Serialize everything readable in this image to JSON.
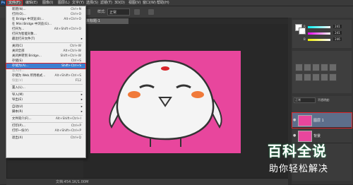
{
  "menubar": {
    "items": [
      {
        "label": "文件(F)",
        "active": true
      },
      {
        "label": "编辑(E)",
        "active": false
      },
      {
        "label": "图像(I)",
        "active": false
      },
      {
        "label": "图层(L)",
        "active": false
      },
      {
        "label": "文字(Y)",
        "active": false
      },
      {
        "label": "选择(S)",
        "active": false
      },
      {
        "label": "滤镜(T)",
        "active": false
      },
      {
        "label": "3D(D)",
        "active": false
      },
      {
        "label": "视图(V)",
        "active": false
      },
      {
        "label": "窗口(W)",
        "active": false
      },
      {
        "label": "帮助(H)",
        "active": false
      }
    ]
  },
  "options": {
    "style_label": "样式:",
    "style_value": "正常"
  },
  "document": {
    "tab": "未标题-1"
  },
  "status": {
    "text": "文档:454.1K/1.00M"
  },
  "file_menu": {
    "items": [
      {
        "label": "新建(N)...",
        "shortcut": "Ctrl+N"
      },
      {
        "label": "打开(O)...",
        "shortcut": "Ctrl+O"
      },
      {
        "label": "在 Bridge 中浏览(B)...",
        "shortcut": "Alt+Ctrl+O"
      },
      {
        "label": "在 Mini Bridge 中浏览(G)...",
        "shortcut": ""
      },
      {
        "label": "打开为...",
        "shortcut": "Alt+Shift+Ctrl+O"
      },
      {
        "label": "打开为智能对象...",
        "shortcut": ""
      },
      {
        "label": "最近打开文件(T)",
        "shortcut": "",
        "submenu": true
      },
      {
        "sep": true
      },
      {
        "label": "关闭(C)",
        "shortcut": "Ctrl+W"
      },
      {
        "label": "关闭全部",
        "shortcut": "Alt+Ctrl+W"
      },
      {
        "label": "关闭并转到 Bridge...",
        "shortcut": "Shift+Ctrl+W"
      },
      {
        "label": "存储(S)",
        "shortcut": "Ctrl+S"
      },
      {
        "label": "存储为(A)...",
        "shortcut": "Shift+Ctrl+S",
        "highlight": true
      },
      {
        "label": "签入(I)...",
        "shortcut": "",
        "disabled": true
      },
      {
        "label": "存储为 Web 所用格式...",
        "shortcut": "Alt+Shift+Ctrl+S"
      },
      {
        "label": "恢复(V)",
        "shortcut": "F12",
        "disabled": true
      },
      {
        "sep": true
      },
      {
        "label": "置入(L)...",
        "shortcut": ""
      },
      {
        "sep": true
      },
      {
        "label": "导入(M)",
        "shortcut": "",
        "submenu": true
      },
      {
        "label": "导出(E)",
        "shortcut": "",
        "submenu": true
      },
      {
        "sep": true
      },
      {
        "label": "自动(U)",
        "shortcut": "",
        "submenu": true
      },
      {
        "label": "脚本(R)",
        "shortcut": "",
        "submenu": true
      },
      {
        "sep": true
      },
      {
        "label": "文件简介(F)...",
        "shortcut": "Alt+Shift+Ctrl+I"
      },
      {
        "sep": true
      },
      {
        "label": "打印(P)...",
        "shortcut": "Ctrl+P"
      },
      {
        "label": "打印一份(Y)",
        "shortcut": "Alt+Shift+Ctrl+P"
      },
      {
        "sep": true
      },
      {
        "label": "退出(X)",
        "shortcut": "Ctrl+Q"
      }
    ]
  },
  "color_panel": {
    "r": "241",
    "g": "241",
    "b": "246",
    "r_label": "R",
    "g_label": "G",
    "b_label": "B"
  },
  "layers": {
    "blend": "正常",
    "opacity_label": "不透明度:",
    "rows": [
      {
        "name": "图层 1",
        "selected": true
      },
      {
        "name": "背景",
        "selected": false
      }
    ]
  },
  "watermark": {
    "title": "百科全说",
    "subtitle": "助你轻松解决"
  },
  "colors": {
    "canvas": "#e8469d",
    "highlight": "#3c7fd1",
    "annotation": "#d9252a"
  }
}
